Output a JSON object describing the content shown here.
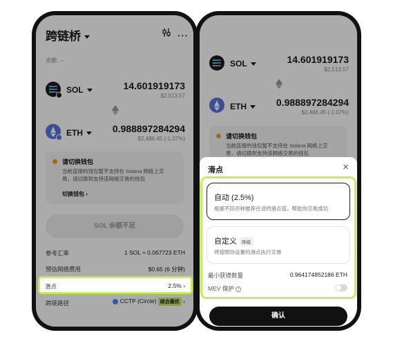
{
  "left": {
    "title": "跨链桥",
    "balance_label": "余额: --",
    "from_token": {
      "symbol": "SOL",
      "amount": "14.601919173",
      "fiat": "$2,513.57"
    },
    "to_token": {
      "symbol": "ETH",
      "amount": "0.988897284294",
      "fiat": "$2,486.45 (-1.07%)"
    },
    "warning": {
      "title": "请切换钱包",
      "body": "当前连接的钱包暂不支持在 Solana 网络上交易，请切换到支持该网络交易的钱包",
      "link": "切换钱包"
    },
    "action_button": "SOL 余额不足",
    "rows": [
      {
        "label": "参考汇率",
        "value": "1 SOL ≈ 0.067723 ETH"
      },
      {
        "label": "预估网络费用",
        "value": "$0.65 (6 分钟)"
      },
      {
        "label": "滑点",
        "value": "2.5%"
      },
      {
        "label": "跨链路径",
        "value": "CCTP (Circle)",
        "badge": "综合最优"
      }
    ]
  },
  "right": {
    "from_token": {
      "symbol": "SOL",
      "amount": "14.601919173",
      "fiat": "$2,513.57"
    },
    "to_token": {
      "symbol": "ETH",
      "amount": "0.988897284294",
      "fiat": "$2,486.45 (-1.07%)"
    },
    "warning": {
      "title": "请切换钱包",
      "body": "当前连接的钱包暂不支持在 Solana 网络上交易，请切换到支持该网络交易的钱包"
    },
    "sheet": {
      "title": "滑点",
      "auto": {
        "title": "自动 (2.5%)",
        "desc": "根据不同币种推荐合适的滑点值，帮助你交易成功"
      },
      "custom": {
        "title": "自定义",
        "tag": "降级",
        "desc": "将按照你设置的滑点执行交易"
      },
      "min_receive_label": "最小获得数量",
      "min_receive_value": "0.964174852186 ETH",
      "mev_label": "MEV 保护",
      "confirm": "确认"
    }
  },
  "colors": {
    "highlight": "#c7f05a",
    "warning": "#f0a020",
    "badge_bg": "#c7f05a",
    "eth": "#5a78d8"
  }
}
